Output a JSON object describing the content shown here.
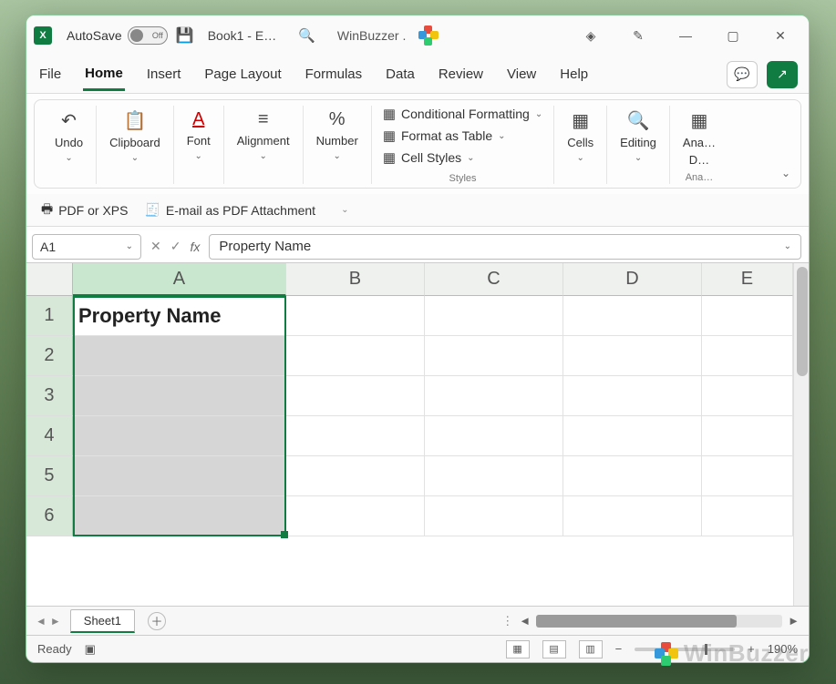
{
  "titlebar": {
    "autosave_label": "AutoSave",
    "autosave_state": "Off",
    "doc_title": "Book1 - E…",
    "winbuzzer": "WinBuzzer .",
    "icons": {
      "save": "save-icon",
      "search": "search-icon",
      "diamond": "premium-icon",
      "wand": "designer-icon",
      "minimize": "minimize-icon",
      "restore": "restore-icon",
      "close": "close-icon"
    }
  },
  "tabs": [
    "File",
    "Home",
    "Insert",
    "Page Layout",
    "Formulas",
    "Data",
    "Review",
    "View",
    "Help"
  ],
  "active_tab": "Home",
  "right_tabs": {
    "comment": "💬",
    "share": "↗"
  },
  "ribbon": {
    "undo": "Undo",
    "clipboard": "Clipboard",
    "font": "Font",
    "alignment": "Alignment",
    "number": "Number",
    "cond_fmt": "Conditional Formatting",
    "fmt_table": "Format as Table",
    "cell_styles": "Cell Styles",
    "styles_label": "Styles",
    "cells": "Cells",
    "editing": "Editing",
    "analyze": "Ana…",
    "analyze2": "D…",
    "analyze_grp": "Ana…"
  },
  "qat2": {
    "pdf": "PDF or XPS",
    "email": "E-mail as PDF Attachment"
  },
  "formula": {
    "namebox": "A1",
    "fx": "fx",
    "value": "Property Name"
  },
  "grid": {
    "columns": [
      "A",
      "B",
      "C",
      "D",
      "E"
    ],
    "rows": [
      1,
      2,
      3,
      4,
      5,
      6
    ],
    "A1": "Property Name",
    "selected_column": "A",
    "selected_rows": [
      1,
      2,
      3,
      4,
      5,
      6
    ]
  },
  "sheets": {
    "active": "Sheet1"
  },
  "status": {
    "ready": "Ready",
    "zoom": "190%"
  }
}
